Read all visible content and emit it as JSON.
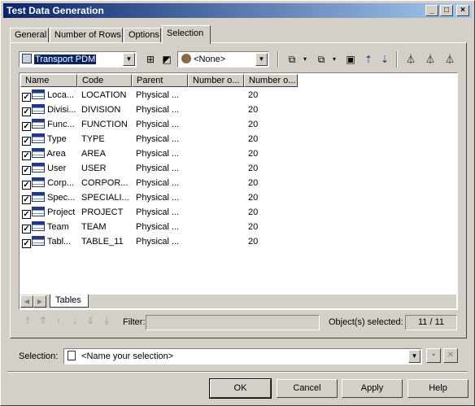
{
  "window": {
    "title": "Test Data Generation",
    "controls": {
      "minimize": "_",
      "maximize": "□",
      "close": "×"
    }
  },
  "tabs": [
    {
      "label": "General"
    },
    {
      "label": "Number of Rows"
    },
    {
      "label": "Options"
    },
    {
      "label": "Selection",
      "active": true
    }
  ],
  "toolbar": {
    "model_combo": {
      "value": "Transport PDM",
      "icon": "model-icon"
    },
    "owner_combo": {
      "value": "<None>",
      "icon": "user-icon"
    },
    "icons": [
      "include-subpackages-icon",
      "include-composite-icon",
      "select-all-icon",
      "deselect-all-icon",
      "use-graphical-selection-icon",
      "move-to-top-icon",
      "move-to-bottom-icon",
      "filter-icon",
      "filter-clear-icon",
      "filter-define-icon"
    ]
  },
  "list": {
    "columns": [
      "Name",
      "Code",
      "Parent",
      "Number o...",
      "Number o..."
    ],
    "rows": [
      {
        "name": "Loca...",
        "code": "LOCATION",
        "parent": "Physical ...",
        "n1": "",
        "n2": "20"
      },
      {
        "name": "Divisi...",
        "code": "DIVISION",
        "parent": "Physical ...",
        "n1": "",
        "n2": "20"
      },
      {
        "name": "Func...",
        "code": "FUNCTION",
        "parent": "Physical ...",
        "n1": "",
        "n2": "20"
      },
      {
        "name": "Type",
        "code": "TYPE",
        "parent": "Physical ...",
        "n1": "",
        "n2": "20"
      },
      {
        "name": "Area",
        "code": "AREA",
        "parent": "Physical ...",
        "n1": "",
        "n2": "20"
      },
      {
        "name": "User",
        "code": "USER",
        "parent": "Physical ...",
        "n1": "",
        "n2": "20"
      },
      {
        "name": "Corp...",
        "code": "CORPOR...",
        "parent": "Physical ...",
        "n1": "",
        "n2": "20"
      },
      {
        "name": "Spec...",
        "code": "SPECIALI...",
        "parent": "Physical ...",
        "n1": "",
        "n2": "20"
      },
      {
        "name": "Project",
        "code": "PROJECT",
        "parent": "Physical ...",
        "n1": "",
        "n2": "20"
      },
      {
        "name": "Team",
        "code": "TEAM",
        "parent": "Physical ...",
        "n1": "",
        "n2": "20"
      },
      {
        "name": "Tabl...",
        "code": "TABLE_11",
        "parent": "Physical ...",
        "n1": "",
        "n2": "20"
      }
    ],
    "sheet_tab": "Tables"
  },
  "status": {
    "filter_label": "Filter:",
    "filter_value": "",
    "selected_label": "Object(s) selected:",
    "selected_count": "11 / 11"
  },
  "selection": {
    "label": "Selection:",
    "value": "<Name your selection>"
  },
  "buttons": {
    "ok": "OK",
    "cancel": "Cancel",
    "apply": "Apply",
    "help": "Help"
  }
}
